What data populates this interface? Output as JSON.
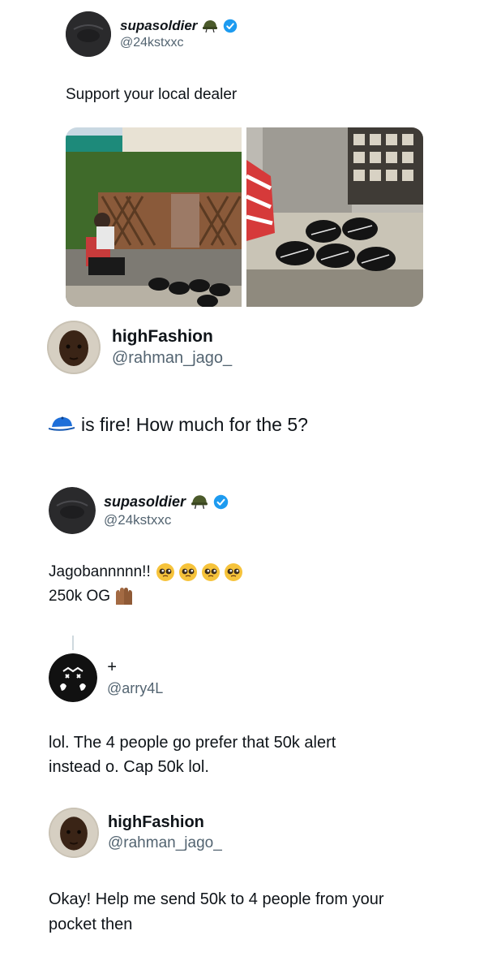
{
  "tweets": [
    {
      "name": "supasoldier",
      "handle": "@24kstxxc",
      "text": "Support your local dealer"
    },
    {
      "name": "highFashion",
      "handle": "@rahman_jago_",
      "text": "is fire! How much for the 5?"
    },
    {
      "name": "supasoldier",
      "handle": "@24kstxxc",
      "line1": "Jagobannnnn!!",
      "line2": "250k OG"
    },
    {
      "name": "+",
      "handle": "@arry4L",
      "line1": "lol. The 4 people go prefer that 50k alert",
      "line2": "instead o. Cap 50k lol."
    },
    {
      "name": "highFashion",
      "handle": "@rahman_jago_",
      "line1": "Okay! Help me send 50k to 4 people from your",
      "line2": "pocket then"
    }
  ],
  "icons": {
    "helmet": "military-helmet-emoji",
    "verified": "verified-badge-icon",
    "cap": "billed-cap-emoji",
    "pleading": "pleading-face-emoji",
    "palms": "palms-up-together-emoji"
  },
  "colors": {
    "verified": "#1d9bf0",
    "text": "#0f1419",
    "secondary": "#536471"
  }
}
